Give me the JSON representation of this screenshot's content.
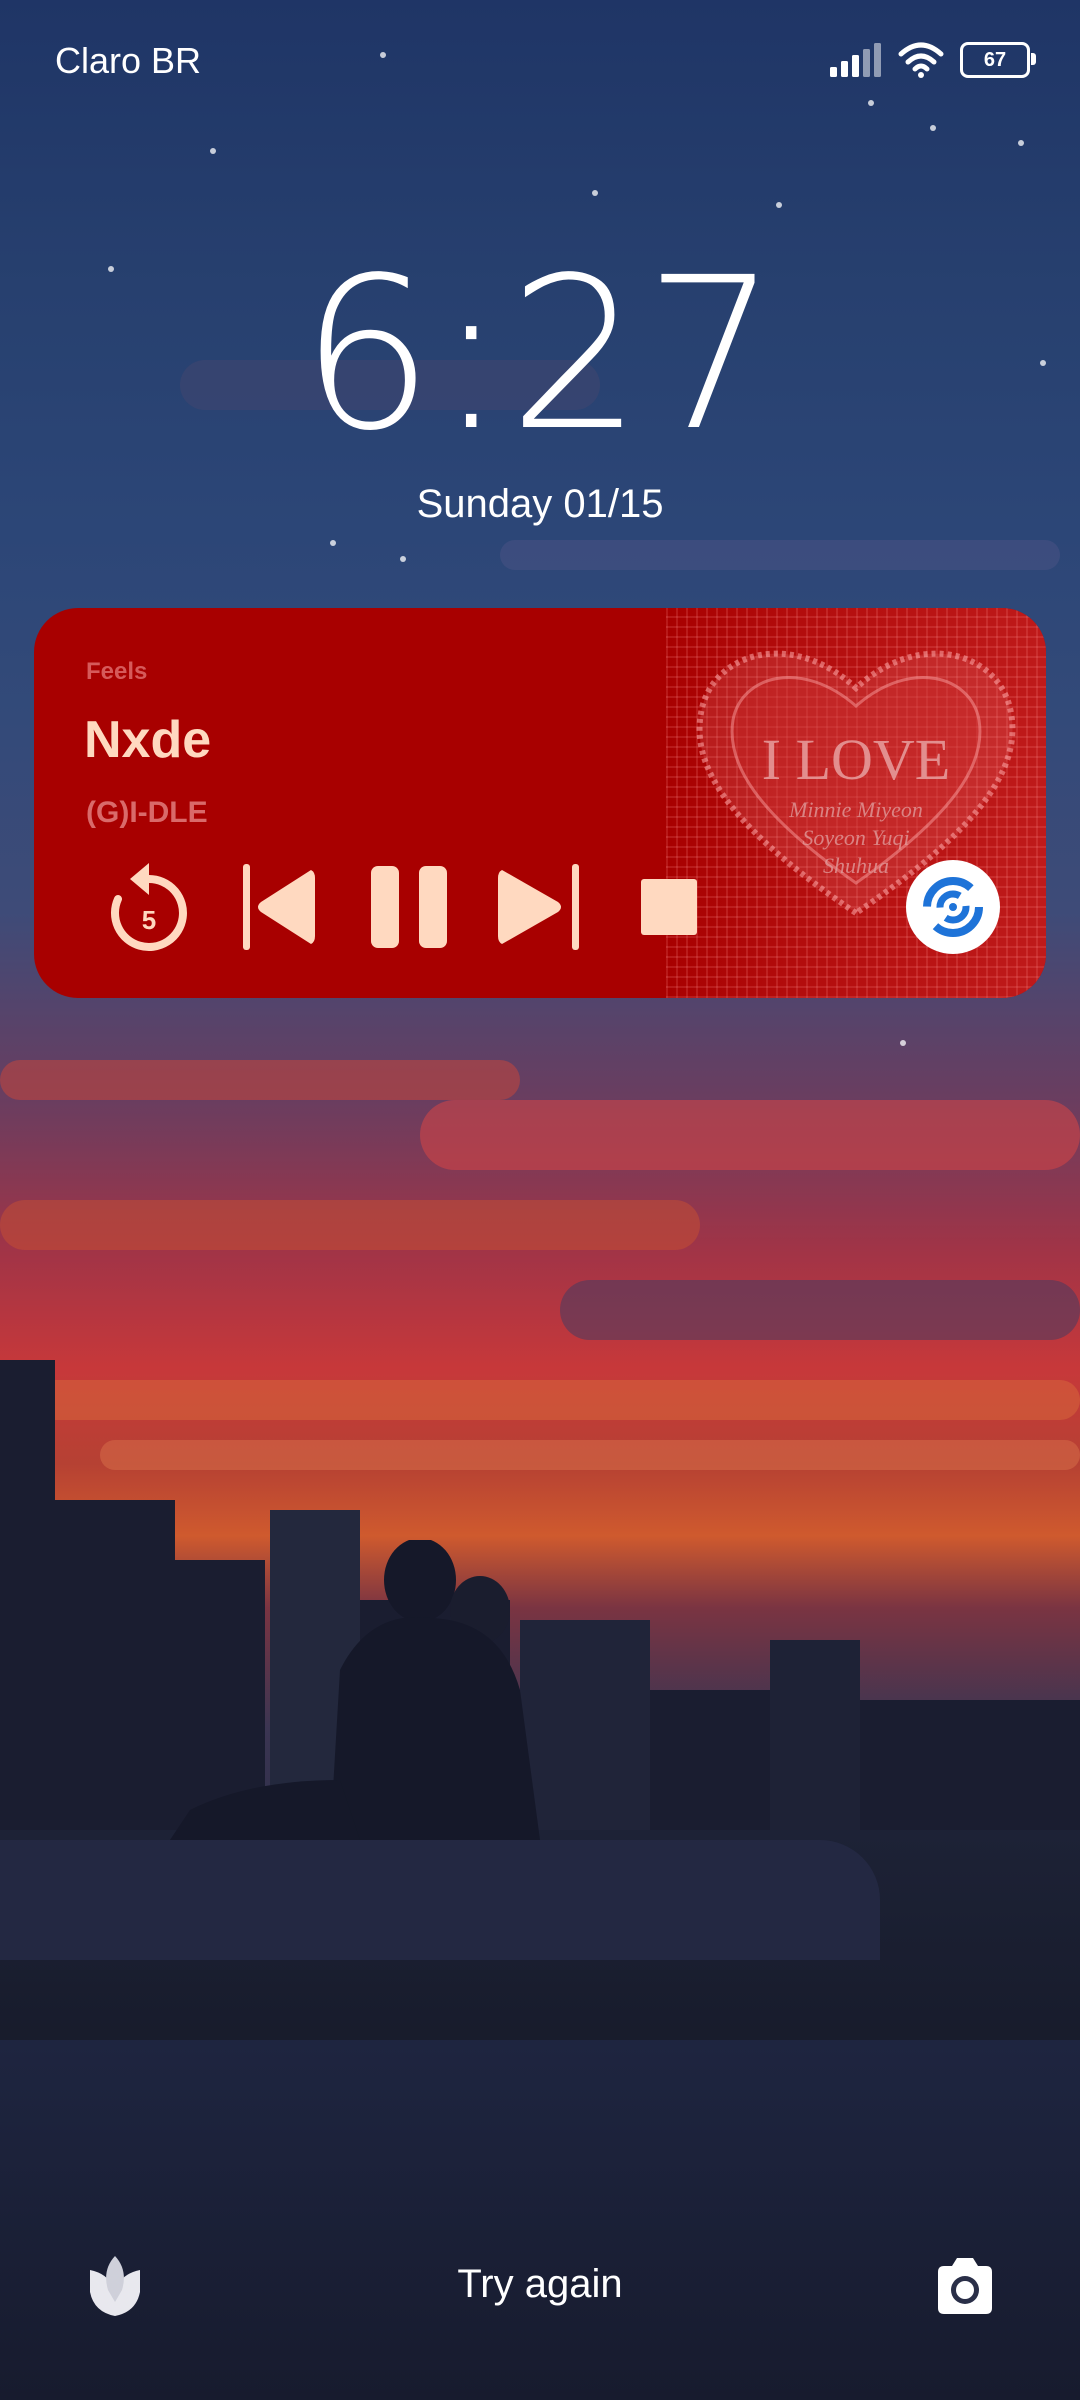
{
  "status_bar": {
    "carrier": "Claro BR",
    "battery_level": "67",
    "icons": [
      "signal-icon",
      "wifi-icon",
      "battery-icon"
    ]
  },
  "lockscreen": {
    "time": "6:27",
    "date": "Sunday 01/15"
  },
  "media_widget": {
    "album": "Feels",
    "title": "Nxde",
    "artist": "(G)I-DLE",
    "album_art": {
      "text": "I LOVE",
      "names": [
        "Minnie Miyeon",
        "Soyeon Yuqi",
        "Shuhua"
      ]
    },
    "rewind_seconds": "5",
    "controls": [
      "rewind-5-icon",
      "previous-icon",
      "pause-icon",
      "next-icon",
      "stop-icon"
    ],
    "background_color": "#a80000",
    "accent_color": "#ffd9c0",
    "cast_color": "#1e73d8"
  },
  "bottom_bar": {
    "hint": "Try again",
    "left_icon": "tulip-icon",
    "right_icon": "camera-icon"
  }
}
